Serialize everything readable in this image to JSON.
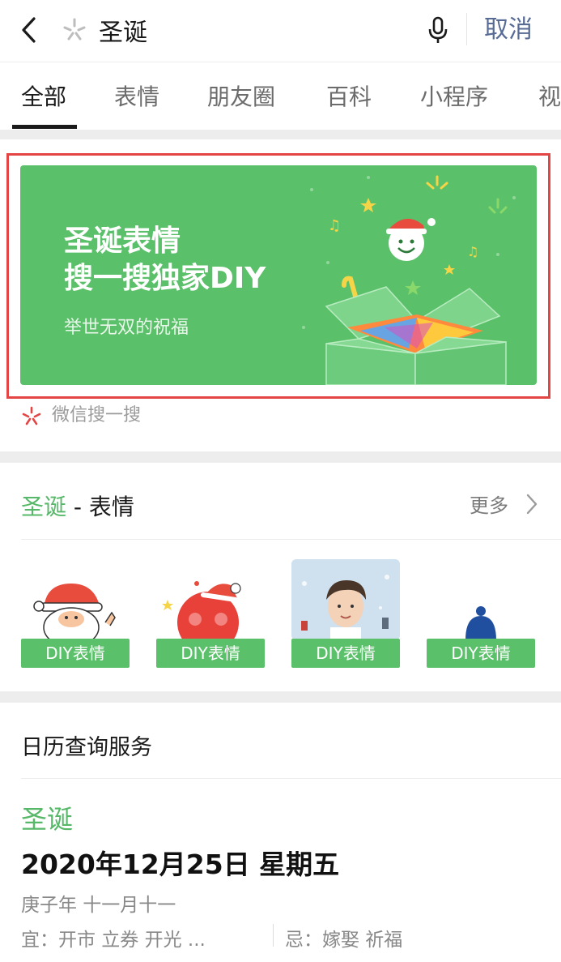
{
  "search": {
    "query": "圣诞",
    "cancel_label": "取消"
  },
  "tabs": [
    {
      "label": "全部"
    },
    {
      "label": "表情"
    },
    {
      "label": "朋友圈"
    },
    {
      "label": "百科"
    },
    {
      "label": "小程序"
    },
    {
      "label": "视"
    }
  ],
  "banner": {
    "title_line1": "圣诞表情",
    "title_line2": "搜一搜独家DIY",
    "subtitle": "举世无双的祝福",
    "source": "微信搜一搜"
  },
  "emoji_section": {
    "keyword": "圣诞",
    "title_suffix": " - 表情",
    "more_label": "更多",
    "cards": [
      {
        "badge": "DIY表情",
        "icon": "santa-emoji-icon"
      },
      {
        "badge": "DIY表情",
        "icon": "apple-santa-hat-icon"
      },
      {
        "badge": "DIY表情",
        "icon": "person-photo-icon"
      },
      {
        "badge": "DIY表情",
        "icon": "blue-hat-icon"
      }
    ]
  },
  "calendar": {
    "header": "日历查询服务",
    "keyword": "圣诞",
    "date": "2020年12月25日 星期五",
    "lunar": "庚子年 十一月十一",
    "yi": "宜：开市 立券 开光 ...",
    "ji": "忌：嫁娶 祈福"
  },
  "colors": {
    "accent_green": "#5bc06a",
    "cancel_blue": "#576b95",
    "highlight_red": "#e34545"
  }
}
